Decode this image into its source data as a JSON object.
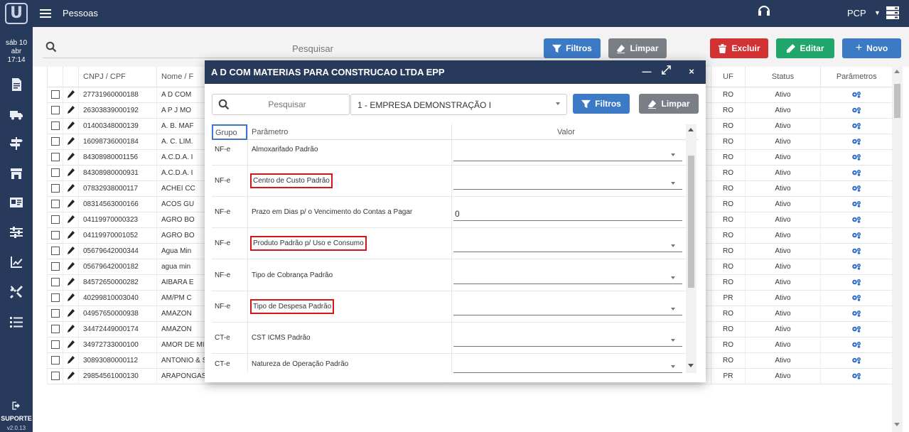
{
  "topbar": {
    "title": "Pessoas",
    "user": "PCP"
  },
  "sidebar": {
    "date": "sáb 10 abr",
    "time": "17:14",
    "icons": [
      "document-icon",
      "truck-icon",
      "signpost-icon",
      "store-icon",
      "id-card-icon",
      "sliders-icon",
      "chart-icon",
      "tools-icon",
      "list-icon"
    ],
    "support_label": "SUPORTE",
    "version": "v2.0.13"
  },
  "toolbar": {
    "search_placeholder": "Pesquisar",
    "filtros_label": "Filtros",
    "limpar_label": "Limpar",
    "excluir_label": "Excluir",
    "editar_label": "Editar",
    "novo_label": "Novo"
  },
  "table": {
    "columns": [
      "",
      "",
      "CNPJ / CPF",
      "Nome / Razão Social",
      "",
      "UF",
      "Status",
      "Parâmetros"
    ],
    "col_cnpj": "CNPJ / CPF",
    "col_nome": "Nome / F",
    "col_uf": "UF",
    "col_status": "Status",
    "col_param": "Parâmetros",
    "rows": [
      {
        "cnpj": "27731960000188",
        "nome": "A D COM",
        "fantasia": "",
        "uf": "RO",
        "status": "Ativo"
      },
      {
        "cnpj": "26303839000192",
        "nome": "A P J MO",
        "fantasia": "",
        "uf": "RO",
        "status": "Ativo"
      },
      {
        "cnpj": "01400348000139",
        "nome": "A. B. MAF",
        "fantasia": "",
        "uf": "RO",
        "status": "Ativo"
      },
      {
        "cnpj": "16098736000184",
        "nome": "A. C. LIM.",
        "fantasia": "",
        "uf": "RO",
        "status": "Ativo"
      },
      {
        "cnpj": "84308980001156",
        "nome": "A.C.D.A. I",
        "fantasia": "",
        "uf": "RO",
        "status": "Ativo"
      },
      {
        "cnpj": "84308980000931",
        "nome": "A.C.D.A. I",
        "fantasia": "",
        "uf": "RO",
        "status": "Ativo"
      },
      {
        "cnpj": "07832938000117",
        "nome": "ACHEI CC",
        "fantasia": "",
        "uf": "RO",
        "status": "Ativo"
      },
      {
        "cnpj": "08314563000166",
        "nome": "ACOS GU",
        "fantasia": "",
        "uf": "RO",
        "status": "Ativo"
      },
      {
        "cnpj": "04119970000323",
        "nome": "AGRO BO",
        "fantasia": "",
        "uf": "RO",
        "status": "Ativo"
      },
      {
        "cnpj": "04119970001052",
        "nome": "AGRO BO",
        "fantasia": "",
        "uf": "RO",
        "status": "Ativo"
      },
      {
        "cnpj": "05679642000344",
        "nome": "Agua Min",
        "fantasia": "",
        "uf": "RO",
        "status": "Ativo"
      },
      {
        "cnpj": "05679642000182",
        "nome": "agua min",
        "fantasia": "",
        "uf": "RO",
        "status": "Ativo"
      },
      {
        "cnpj": "84572650000282",
        "nome": "AIBARA E",
        "fantasia": "",
        "uf": "RO",
        "status": "Ativo"
      },
      {
        "cnpj": "40299810003040",
        "nome": "AM/PM C",
        "fantasia": "",
        "uf": "PR",
        "status": "Ativo"
      },
      {
        "cnpj": "04957650000938",
        "nome": "AMAZON",
        "fantasia": "",
        "uf": "RO",
        "status": "Ativo"
      },
      {
        "cnpj": "34472449000174",
        "nome": "AMAZON",
        "fantasia": "",
        "uf": "RO",
        "status": "Ativo"
      },
      {
        "cnpj": "34972733000100",
        "nome": "AMOR DE MINAS COM. DE DOCES E CONFEITOS EIRELI",
        "fantasia": "AMOR DE MINAS COM. DE DOCES E CONFEITOS EIRELI",
        "uf": "RO",
        "status": "Ativo"
      },
      {
        "cnpj": "30893080000112",
        "nome": "ANTONIO & SOUZA COMERCIO DE MATERIAIS PARA CONSTRUCAO LTDA",
        "fantasia": "ANTONIO & SOUZA COMERCIO DE MATERIAIS PARA CONSTRUCAO LTDA",
        "uf": "RO",
        "status": "Ativo"
      },
      {
        "cnpj": "29854561000130",
        "nome": "ARAPONGAS COM. DE BRINDES PROMOCIONAIS - EIRELI",
        "fantasia": "ARAPONGAS COM. DE BRINDES PROMOCIONAIS - EIRELI",
        "uf": "PR",
        "status": "Ativo"
      }
    ]
  },
  "modal": {
    "title": "A D COM MATERIAS PARA CONSTRUCAO LTDA EPP",
    "search_placeholder": "Pesquisar",
    "empresa": "1 - EMPRESA DEMONSTRAÇÃO I",
    "filtros_label": "Filtros",
    "limpar_label": "Limpar",
    "col_grupo": "Grupo",
    "col_parametro": "Parâmetro",
    "col_valor": "Valor",
    "rows": [
      {
        "grupo": "NF-e",
        "parametro": "Almoxarifado Padrão",
        "valor": "",
        "highlighted": false,
        "dropdown": true
      },
      {
        "grupo": "NF-e",
        "parametro": "Centro de Custo Padrão",
        "valor": "",
        "highlighted": true,
        "dropdown": true
      },
      {
        "grupo": "NF-e",
        "parametro": "Prazo em Dias p/ o Vencimento do Contas a Pagar",
        "valor": "0",
        "highlighted": false,
        "dropdown": false
      },
      {
        "grupo": "NF-e",
        "parametro": "Produto Padrão p/ Uso e Consumo",
        "valor": "",
        "highlighted": true,
        "dropdown": true
      },
      {
        "grupo": "NF-e",
        "parametro": "Tipo de Cobrança Padrão",
        "valor": "",
        "highlighted": false,
        "dropdown": true
      },
      {
        "grupo": "NF-e",
        "parametro": "Tipo de Despesa Padrão",
        "valor": "",
        "highlighted": true,
        "dropdown": true
      },
      {
        "grupo": "CT-e",
        "parametro": "CST ICMS Padrão",
        "valor": "",
        "highlighted": false,
        "dropdown": true
      },
      {
        "grupo": "CT-e",
        "parametro": "Natureza de Operação Padrão",
        "valor": "",
        "highlighted": false,
        "dropdown": true
      }
    ]
  },
  "colors": {
    "navy": "#283a5b",
    "blue": "#3c7ac6",
    "gray": "#7a7f86",
    "red": "#d33234",
    "green": "#20a56a",
    "highlight": "#d41616"
  }
}
